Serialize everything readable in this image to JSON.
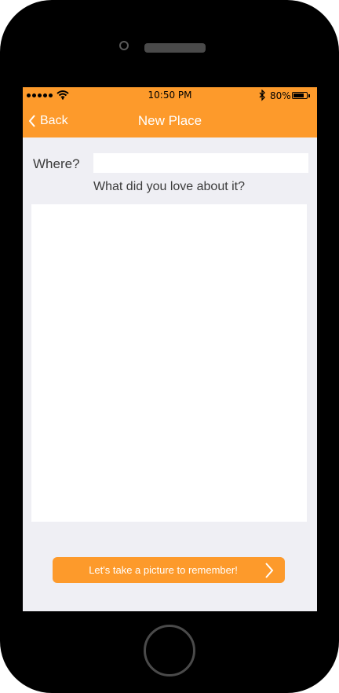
{
  "device": {
    "frame_color": "#000000",
    "accent_color": "#fd9a2b",
    "screen_background": "#efeff4"
  },
  "status_bar": {
    "time": "10:50 PM",
    "battery_percent": "80%",
    "battery_level": 0.8,
    "signal_dots": 5,
    "icons": [
      "signal-dots-icon",
      "wifi-icon",
      "bluetooth-icon",
      "battery-icon"
    ]
  },
  "nav_bar": {
    "back_label": "Back",
    "title": "New Place",
    "back_icon": "chevron-left-icon"
  },
  "form": {
    "where_label": "Where?",
    "where_value": "",
    "love_label": "What did you love about it?",
    "love_value": ""
  },
  "action_button": {
    "label": "Let's take a picture to remember!",
    "icon": "chevron-right-icon"
  }
}
